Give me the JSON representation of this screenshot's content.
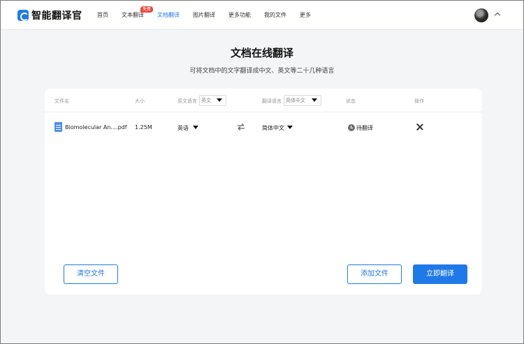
{
  "header": {
    "logo_text": "智能翻译官",
    "nav": [
      {
        "label": "首页"
      },
      {
        "label": "文本翻译",
        "badge": "免费"
      },
      {
        "label": "文档翻译",
        "active": true
      },
      {
        "label": "图片翻译"
      },
      {
        "label": "更多功能"
      },
      {
        "label": "我的文件"
      },
      {
        "label": "更多"
      }
    ]
  },
  "hero": {
    "title": "文档在线翻译",
    "subtitle": "可将文档中的文字翻译成中文、英文等二十几种语言"
  },
  "table": {
    "columns": {
      "filename": "文件名",
      "size": "大小",
      "source_lang": "原文语言",
      "source_lang_value": "英文",
      "target_lang": "翻译语言",
      "target_lang_value": "简体中文",
      "status": "状态",
      "action": "操作"
    },
    "rows": [
      {
        "filename": "Biomolecular An....pdf",
        "size": "1.25M",
        "source_lang": "英语",
        "target_lang": "简体中文",
        "status": "待翻译"
      }
    ]
  },
  "buttons": {
    "clear": "清空文件",
    "add": "添加文件",
    "translate": "立即翻译"
  },
  "colors": {
    "accent": "#1f7ae8",
    "badge": "#e8463b"
  }
}
